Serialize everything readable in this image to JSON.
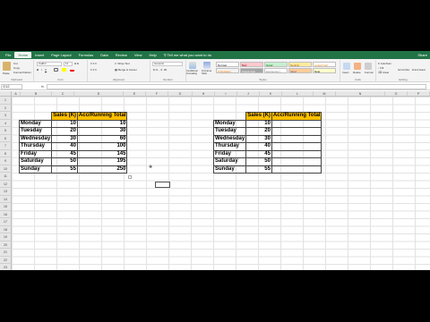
{
  "menu": {
    "tabs": [
      "File",
      "Home",
      "Insert",
      "Page Layout",
      "Formulas",
      "Data",
      "Review",
      "View",
      "Help"
    ],
    "active_tab": "Home",
    "search_label": "Tell me what you want to do",
    "share_label": "Share"
  },
  "ribbon": {
    "clipboard": {
      "label": "Clipboard",
      "cut": "Cut",
      "copy": "Copy",
      "format_painter": "Format Painter",
      "paste": "Paste"
    },
    "font": {
      "label": "Font",
      "font_name": "Calibri",
      "font_size": "11"
    },
    "alignment": {
      "label": "Alignment",
      "wrap_text": "Wrap Text",
      "merge_center": "Merge & Center"
    },
    "number": {
      "label": "Number",
      "format": "General"
    },
    "styles": {
      "label": "Styles",
      "conditional_formatting": "Conditional Formatting",
      "format_as_table": "Format as Table",
      "cells": [
        {
          "name": "Normal",
          "bg": "#ffffff",
          "fg": "#000000"
        },
        {
          "name": "Bad",
          "bg": "#ffc7ce",
          "fg": "#9c0006"
        },
        {
          "name": "Good",
          "bg": "#c6efce",
          "fg": "#006100"
        },
        {
          "name": "Neutral",
          "bg": "#ffeb9c",
          "fg": "#9c5700"
        },
        {
          "name": "Calculation",
          "bg": "#f2f2f2",
          "fg": "#fa7d00"
        },
        {
          "name": "Check Cell",
          "bg": "#a5a5a5",
          "fg": "#ffffff"
        },
        {
          "name": "Explanatory...",
          "bg": "#ffffff",
          "fg": "#7f7f7f"
        },
        {
          "name": "Input",
          "bg": "#ffcc99",
          "fg": "#3f3f76"
        },
        {
          "name": "Linked Cell",
          "bg": "#ffffff",
          "fg": "#fa7d00"
        },
        {
          "name": "Note",
          "bg": "#ffffcc",
          "fg": "#000000"
        }
      ]
    },
    "cells": {
      "label": "Cells",
      "insert": "Insert",
      "delete": "Delete",
      "format": "Format"
    },
    "editing": {
      "label": "Editing",
      "autosum": "AutoSum",
      "fill": "Fill",
      "clear": "Clear",
      "sort_filter": "Sort & Filter",
      "find_select": "Find & Select"
    }
  },
  "formula_bar": {
    "name_box": "G12",
    "fx": "fx",
    "content": ""
  },
  "columns": [
    "A",
    "B",
    "C",
    "D",
    "E",
    "F",
    "G",
    "H",
    "I",
    "J",
    "K",
    "L",
    "M",
    "N",
    "O",
    "P",
    "Q",
    "R"
  ],
  "rows": [
    "1",
    "2",
    "3",
    "4",
    "5",
    "6",
    "7",
    "8",
    "9",
    "10",
    "11",
    "12",
    "13",
    "14",
    "15",
    "16",
    "17",
    "18",
    "19",
    "20",
    "21",
    "22",
    "23",
    "24",
    "25",
    "26",
    "27",
    "28",
    "29",
    "30"
  ],
  "table_left": {
    "headers": [
      "",
      "Sales (K)",
      "Acc/Running Total"
    ],
    "rows": [
      {
        "day": "Monday",
        "sales": "10",
        "total": "10"
      },
      {
        "day": "Tuesday",
        "sales": "20",
        "total": "30"
      },
      {
        "day": "Wednesday",
        "sales": "30",
        "total": "60"
      },
      {
        "day": "Thursday",
        "sales": "40",
        "total": "100"
      },
      {
        "day": "Friday",
        "sales": "45",
        "total": "145"
      },
      {
        "day": "Saturday",
        "sales": "50",
        "total": "195"
      },
      {
        "day": "Sunday",
        "sales": "55",
        "total": "250"
      }
    ]
  },
  "table_right": {
    "headers": [
      "",
      "Sales (K)",
      "Acc/Running Total"
    ],
    "rows": [
      {
        "day": "Monday",
        "sales": "10",
        "total": ""
      },
      {
        "day": "Tuesday",
        "sales": "20",
        "total": ""
      },
      {
        "day": "Wednesday",
        "sales": "30",
        "total": ""
      },
      {
        "day": "Thursday",
        "sales": "40",
        "total": ""
      },
      {
        "day": "Friday",
        "sales": "45",
        "total": ""
      },
      {
        "day": "Saturday",
        "sales": "50",
        "total": ""
      },
      {
        "day": "Sunday",
        "sales": "55",
        "total": ""
      }
    ]
  },
  "colors": {
    "excel_green": "#217346",
    "header_fill": "#ffc000"
  }
}
